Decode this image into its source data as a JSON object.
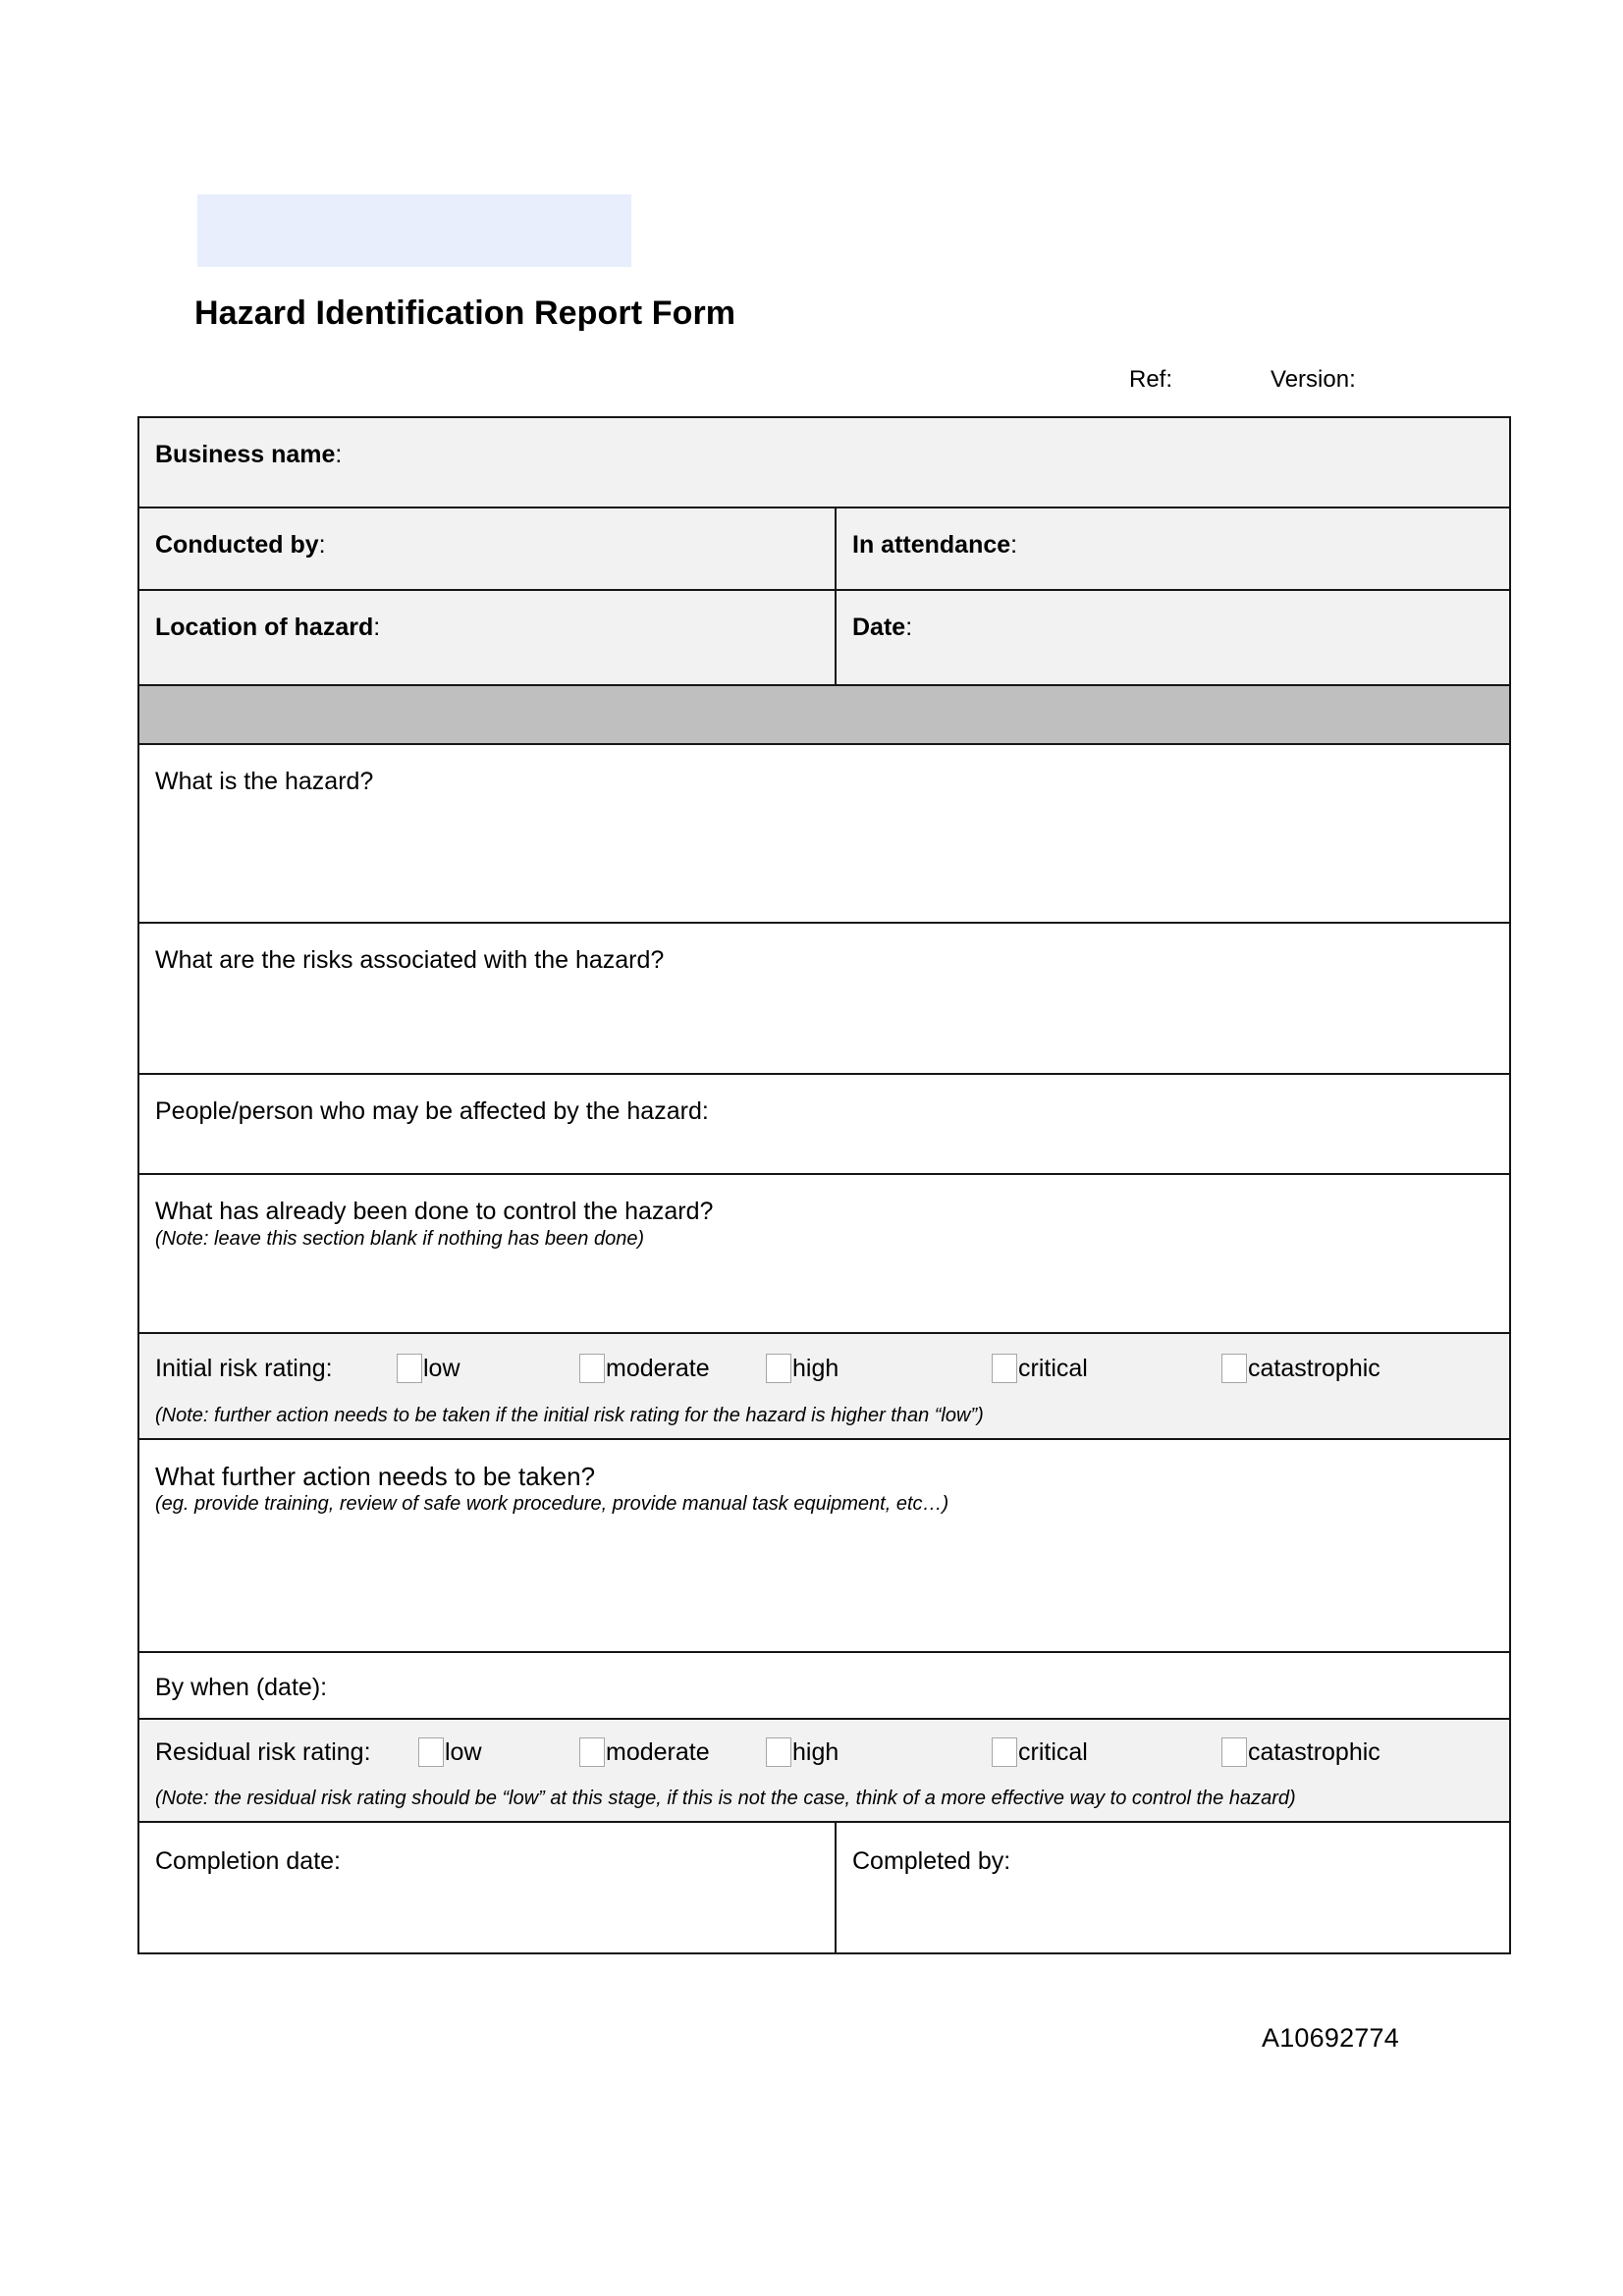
{
  "document": {
    "title": "Hazard Identification Report Form",
    "logo_placeholder": "",
    "ref_label": "Ref:",
    "version_label": "Version:",
    "doc_code": "A10692774",
    "accent_color": "#e8eefc",
    "shade_color": "#f2f2f2",
    "band_color": "#bfbfbf"
  },
  "header_fields": {
    "business_name": "Business name",
    "colon": ":",
    "conducted_by": "Conducted by",
    "in_attendance": "In attendance",
    "location_of_hazard": "Location of hazard",
    "date": "Date"
  },
  "sections": {
    "hazard_question": "What is the hazard?",
    "risks_question": "What are the risks associated with the hazard?",
    "people_affected": "People/person who may be affected by the hazard:",
    "already_done_question": "What has already been done to control the hazard?",
    "already_done_note": "(Note: leave this section blank if nothing has been done)",
    "further_action_question": "What further action needs to be taken?",
    "further_action_note": "(eg. provide training, review of safe work procedure,  provide manual task equipment, etc…)",
    "by_when": "By when (date):",
    "completion_date": "Completion date:",
    "completed_by": "Completed by:"
  },
  "initial_risk": {
    "label": "Initial risk rating:",
    "options": [
      "low",
      "moderate",
      "high",
      "critical",
      "catastrophic"
    ],
    "note": "(Note: further action needs to be taken if the initial risk rating for the hazard is higher than “low”)"
  },
  "residual_risk": {
    "label": "Residual risk rating:",
    "options": [
      "low",
      "moderate",
      "high",
      "critical",
      "catastrophic"
    ],
    "note": "(Note: the residual risk rating should be “low” at this stage, if this is not the case, think of a more effective way to control the hazard)"
  }
}
